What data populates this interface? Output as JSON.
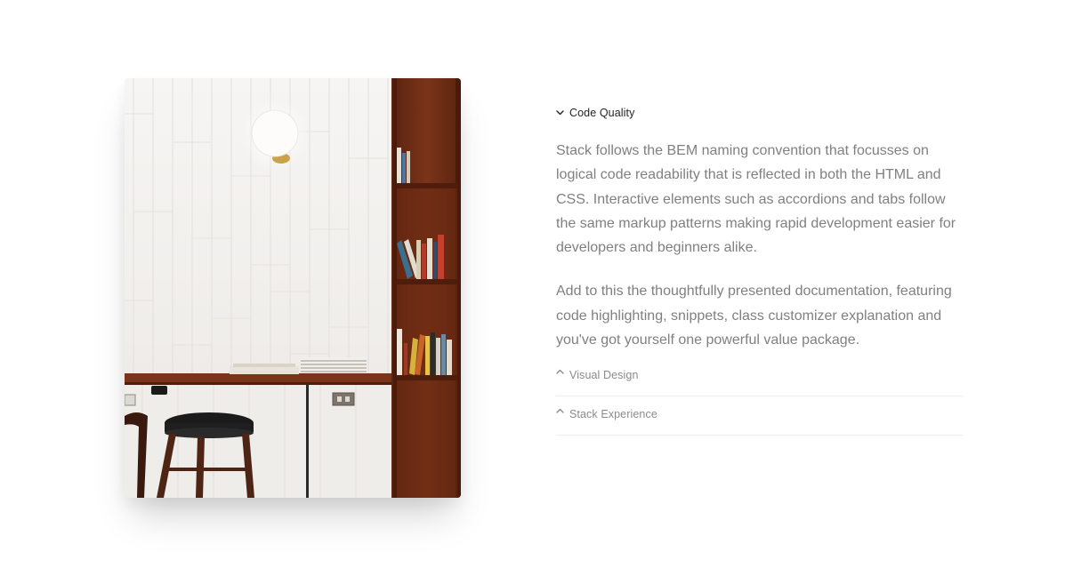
{
  "image": {
    "alt": "",
    "icon": "cafe-interior-photo"
  },
  "accordion": {
    "items": [
      {
        "title": "Code Quality",
        "state": "open",
        "paragraphs": [
          "Stack follows the BEM naming convention that focusses on logical code readability that is reflected in both the HTML and CSS. Interactive elements such as accordions and tabs follow the same markup patterns making rapid development easier for developers and beginners alike.",
          "Add to this the thoughtfully presented documentation, featuring code highlighting, snippets, class customizer explanation and you've got yourself one powerful value package."
        ]
      },
      {
        "title": "Visual Design",
        "state": "closed"
      },
      {
        "title": "Stack Experience",
        "state": "closed"
      }
    ]
  },
  "colors": {
    "active_title": "#252525",
    "inactive_title": "#8b8b8b",
    "body_text": "#808080",
    "divider": "#efefef",
    "wood": "#6e2f18"
  }
}
